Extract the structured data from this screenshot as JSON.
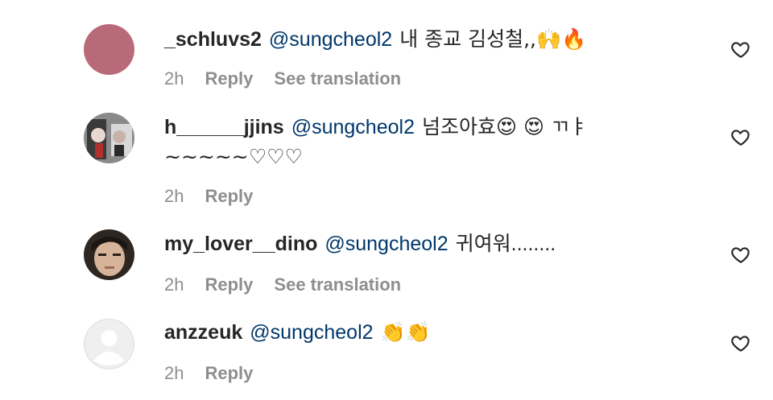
{
  "comments": [
    {
      "username": "_schluvs2",
      "mention": "@sungcheol2",
      "text": "내 종교 김성철,,🙌🔥",
      "continuation": "",
      "time": "2h",
      "reply": "Reply",
      "translation": "See translation",
      "avatar_color": "#b96a78"
    },
    {
      "username": "h______jjins",
      "mention": "@sungcheol2",
      "text": "넘조아효😍 😍 ㄲㅑ",
      "continuation": "~~~~~♡♡♡",
      "time": "2h",
      "reply": "Reply",
      "translation": "",
      "avatar_color": "#6b6b6b"
    },
    {
      "username": "my_lover__dino",
      "mention": "@sungcheol2",
      "text": "귀여워........",
      "continuation": "",
      "time": "2h",
      "reply": "Reply",
      "translation": "See translation",
      "avatar_color": "#4a4038"
    },
    {
      "username": "anzzeuk",
      "mention": "@sungcheol2",
      "text": "👏👏",
      "continuation": "",
      "time": "2h",
      "reply": "Reply",
      "translation": "",
      "avatar_color": "#dbdbdb"
    }
  ]
}
